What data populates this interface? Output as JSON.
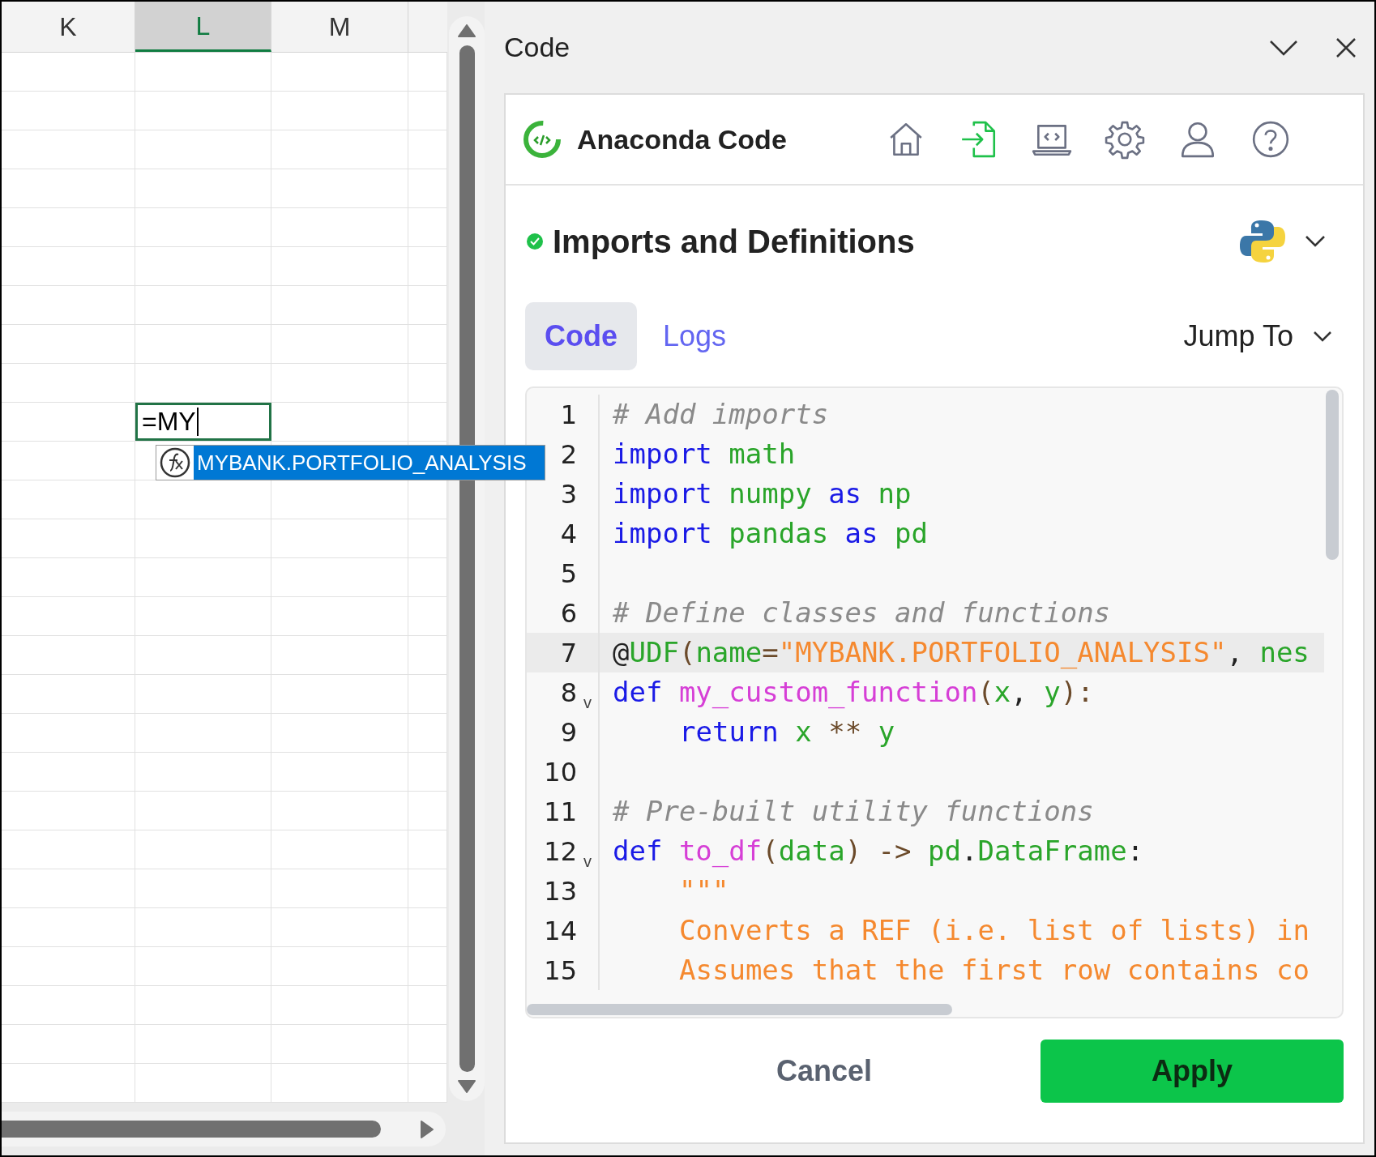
{
  "sheet": {
    "columns": [
      {
        "label": "K",
        "selected": false
      },
      {
        "label": "L",
        "selected": true
      },
      {
        "label": "M",
        "selected": false
      }
    ],
    "active_cell": {
      "value": "=MY"
    },
    "autocomplete": {
      "items": [
        {
          "text": "MYBANK.PORTFOLIO_ANALYSIS",
          "selected": true
        }
      ]
    }
  },
  "pane": {
    "title": "Code"
  },
  "addin": {
    "name": "Anaconda Code",
    "toolbar": [
      {
        "kind": "home",
        "selected": false
      },
      {
        "kind": "import",
        "selected": true
      },
      {
        "kind": "editor",
        "selected": false
      },
      {
        "kind": "settings",
        "selected": false
      },
      {
        "kind": "account",
        "selected": false
      },
      {
        "kind": "help",
        "selected": false
      }
    ]
  },
  "section": {
    "title": "Imports and Definitions",
    "complete": true
  },
  "tabs": [
    {
      "label": "Code",
      "selected": true
    },
    {
      "label": "Logs",
      "selected": false
    }
  ],
  "jump_to": {
    "label": "Jump To"
  },
  "editor": {
    "lines": [
      {
        "number": "1",
        "current": false,
        "tokens": [
          {
            "text": "# Add imports",
            "kind": "comment"
          }
        ]
      },
      {
        "number": "2",
        "current": false,
        "tokens": [
          {
            "text": "import ",
            "kind": "keyword"
          },
          {
            "text": "math",
            "kind": "name"
          }
        ]
      },
      {
        "number": "3",
        "current": false,
        "tokens": [
          {
            "text": "import ",
            "kind": "keyword"
          },
          {
            "text": "numpy ",
            "kind": "name"
          },
          {
            "text": "as ",
            "kind": "keyword"
          },
          {
            "text": "np",
            "kind": "name"
          }
        ]
      },
      {
        "number": "4",
        "current": false,
        "tokens": [
          {
            "text": "import ",
            "kind": "keyword"
          },
          {
            "text": "pandas ",
            "kind": "name"
          },
          {
            "text": "as ",
            "kind": "keyword"
          },
          {
            "text": "pd",
            "kind": "name"
          }
        ]
      },
      {
        "number": "5",
        "current": false
      },
      {
        "number": "6",
        "current": false,
        "tokens": [
          {
            "text": "# Define classes and functions",
            "kind": "comment"
          }
        ]
      },
      {
        "number": "7",
        "current": true,
        "tokens": [
          {
            "text": "@",
            "kind": "plain"
          },
          {
            "text": "UDF",
            "kind": "name"
          },
          {
            "text": "(",
            "kind": "punct"
          },
          {
            "text": "name",
            "kind": "name"
          },
          {
            "text": "=",
            "kind": "operator"
          },
          {
            "text": "\"MYBANK.PORTFOLIO_ANALYSIS\"",
            "kind": "string"
          },
          {
            "text": ", ",
            "kind": "plain"
          },
          {
            "text": "nes",
            "kind": "name"
          }
        ]
      },
      {
        "number": "8",
        "current": false,
        "fold": "v",
        "tokens": [
          {
            "text": "def ",
            "kind": "keyword"
          },
          {
            "text": "my_custom_function",
            "kind": "function"
          },
          {
            "text": "(",
            "kind": "punct"
          },
          {
            "text": "x",
            "kind": "name"
          },
          {
            "text": ", ",
            "kind": "plain"
          },
          {
            "text": "y",
            "kind": "name"
          },
          {
            "text": "):",
            "kind": "punct"
          }
        ]
      },
      {
        "number": "9",
        "current": false,
        "indented": true,
        "tokens": [
          {
            "text": "return ",
            "kind": "keyword"
          },
          {
            "text": "x ",
            "kind": "name"
          },
          {
            "text": "** ",
            "kind": "operator"
          },
          {
            "text": "y",
            "kind": "name"
          }
        ]
      },
      {
        "number": "10",
        "current": false
      },
      {
        "number": "11",
        "current": false,
        "tokens": [
          {
            "text": "# Pre-built utility functions",
            "kind": "comment"
          }
        ]
      },
      {
        "number": "12",
        "current": false,
        "fold": "v",
        "tokens": [
          {
            "text": "def ",
            "kind": "keyword"
          },
          {
            "text": "to_df",
            "kind": "function"
          },
          {
            "text": "(",
            "kind": "punct"
          },
          {
            "text": "data",
            "kind": "name"
          },
          {
            "text": ") -> ",
            "kind": "punct"
          },
          {
            "text": "pd",
            "kind": "name"
          },
          {
            "text": ".",
            "kind": "plain"
          },
          {
            "text": "DataFrame",
            "kind": "name"
          },
          {
            "text": ":",
            "kind": "plain"
          }
        ]
      },
      {
        "number": "13",
        "current": false,
        "indented": true,
        "tokens": [
          {
            "text": "\"\"\"",
            "kind": "string"
          }
        ]
      },
      {
        "number": "14",
        "current": false,
        "indented": true,
        "tokens": [
          {
            "text": "Converts a REF (i.e. list of lists) in",
            "kind": "string"
          }
        ]
      },
      {
        "number": "15",
        "current": false,
        "indented": true,
        "tokens": [
          {
            "text": "Assumes that the first row contains co",
            "kind": "string"
          }
        ]
      }
    ]
  },
  "buttons": {
    "cancel": "Cancel",
    "apply": "Apply"
  }
}
